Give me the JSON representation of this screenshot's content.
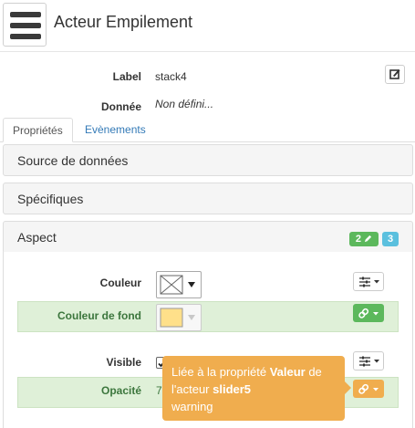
{
  "header": {
    "title": "Acteur Empilement",
    "menu_icon": "hamburger-icon"
  },
  "fields": {
    "label": {
      "label": "Label",
      "value": "stack4"
    },
    "donnee": {
      "label": "Donnée",
      "value": "Non défini..."
    }
  },
  "tabs": [
    {
      "label": "Propriétés",
      "active": true
    },
    {
      "label": "Evènements",
      "active": false
    }
  ],
  "panels": {
    "source": {
      "title": "Source de données"
    },
    "specifiques": {
      "title": "Spécifiques"
    },
    "aspect": {
      "title": "Aspect",
      "badge_bound": "2",
      "badge_count": "3"
    }
  },
  "aspect_rows": {
    "couleur": {
      "label": "Couleur"
    },
    "couleur_fond": {
      "label": "Couleur de fond",
      "swatch": "#ffe08a"
    },
    "visible": {
      "label": "Visible",
      "checked": true
    },
    "opacite": {
      "label": "Opacité",
      "value": "7"
    }
  },
  "tooltip": {
    "text_1": "Liée à la propriété ",
    "bold_1": "Valeur",
    "text_2": " de",
    "text_3": "l'acteur ",
    "bold_2": "slider5",
    "text_4": "warning"
  },
  "colors": {
    "green": "#5cb85c",
    "info": "#5bc0de",
    "warning": "#f0ad4e",
    "row_green_bg": "#dff0d8"
  }
}
